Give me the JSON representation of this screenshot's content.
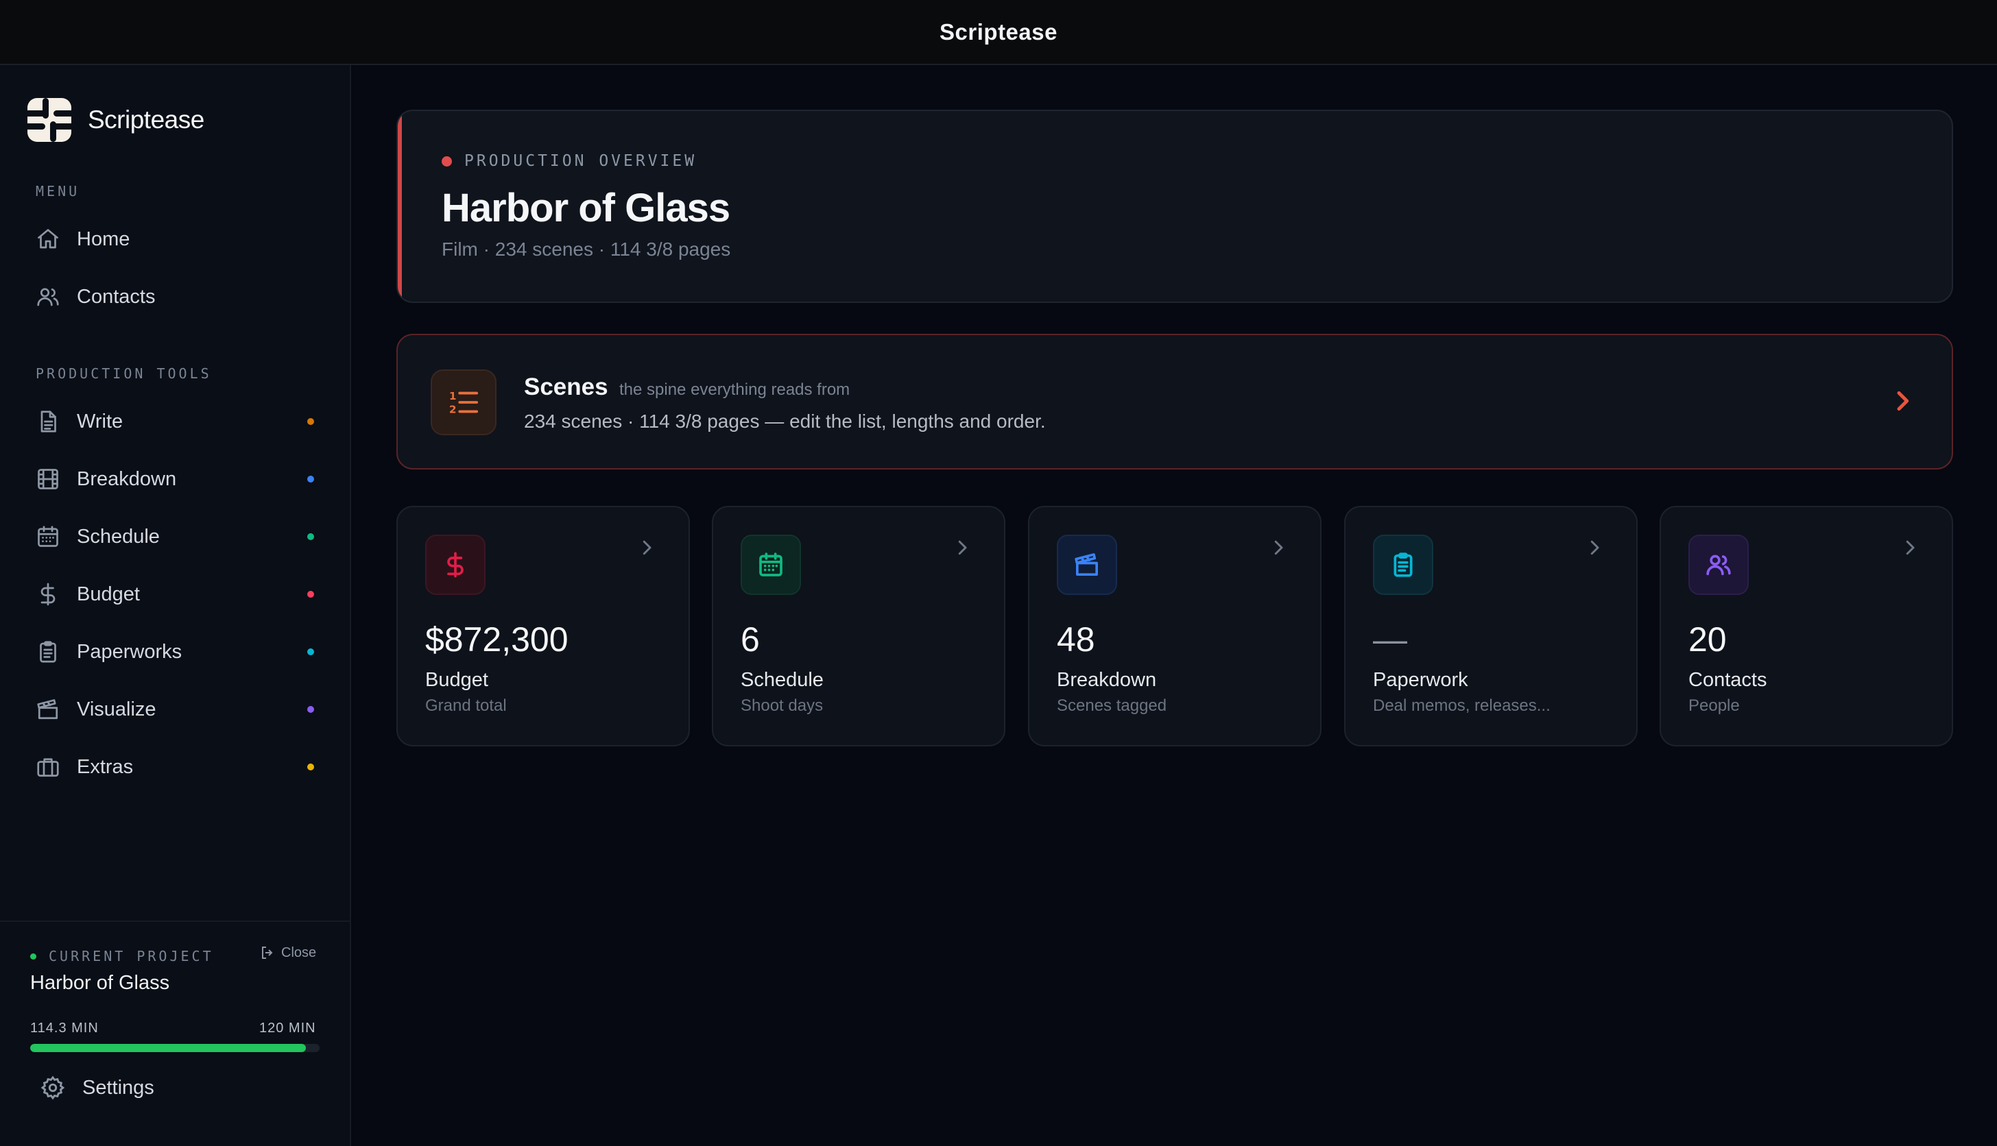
{
  "window": {
    "title": "Scriptease"
  },
  "sidebar": {
    "brand": "Scriptease",
    "menu_label": "MENU",
    "menu_items": [
      {
        "label": "Home",
        "icon": "home-icon"
      },
      {
        "label": "Contacts",
        "icon": "users-icon"
      }
    ],
    "tools_label": "PRODUCTION TOOLS",
    "tools": [
      {
        "label": "Write",
        "icon": "document-icon",
        "dot": "#d97706"
      },
      {
        "label": "Breakdown",
        "icon": "film-icon",
        "dot": "#3b82f6"
      },
      {
        "label": "Schedule",
        "icon": "calendar-icon",
        "dot": "#10b981"
      },
      {
        "label": "Budget",
        "icon": "dollar-icon",
        "dot": "#f43f5e"
      },
      {
        "label": "Paperworks",
        "icon": "clipboard-icon",
        "dot": "#06b6d4"
      },
      {
        "label": "Visualize",
        "icon": "clapper-icon",
        "dot": "#8b5cf6"
      },
      {
        "label": "Extras",
        "icon": "briefcase-icon",
        "dot": "#eab308"
      }
    ],
    "project": {
      "label": "CURRENT PROJECT",
      "close_label": "Close",
      "name": "Harbor of Glass",
      "runtime": "114.3 MIN",
      "target": "120 MIN",
      "progress_fraction": 0.9525
    },
    "settings_label": "Settings"
  },
  "overview": {
    "label": "PRODUCTION OVERVIEW",
    "title": "Harbor of Glass",
    "subtitle": "Film · 234 scenes · 114 3/8 pages",
    "accent": "#d04848"
  },
  "scenes": {
    "title": "Scenes",
    "tagline": "the spine everything reads from",
    "description": "234 scenes · 114 3/8 pages — edit the list, lengths and order."
  },
  "cards": [
    {
      "value": "$872,300",
      "name": "Budget",
      "sub": "Grand total",
      "icon": "dollar-icon",
      "color": "#e11d48"
    },
    {
      "value": "6",
      "name": "Schedule",
      "sub": "Shoot days",
      "icon": "calendar-icon",
      "color": "#10b981"
    },
    {
      "value": "48",
      "name": "Breakdown",
      "sub": "Scenes tagged",
      "icon": "clapper-icon",
      "color": "#3b82f6"
    },
    {
      "value": "—",
      "name": "Paperwork",
      "sub": "Deal memos, releases...",
      "icon": "clipboard-icon",
      "color": "#06b6d4"
    },
    {
      "value": "20",
      "name": "Contacts",
      "sub": "People",
      "icon": "users-icon",
      "color": "#8b5cf6"
    }
  ]
}
